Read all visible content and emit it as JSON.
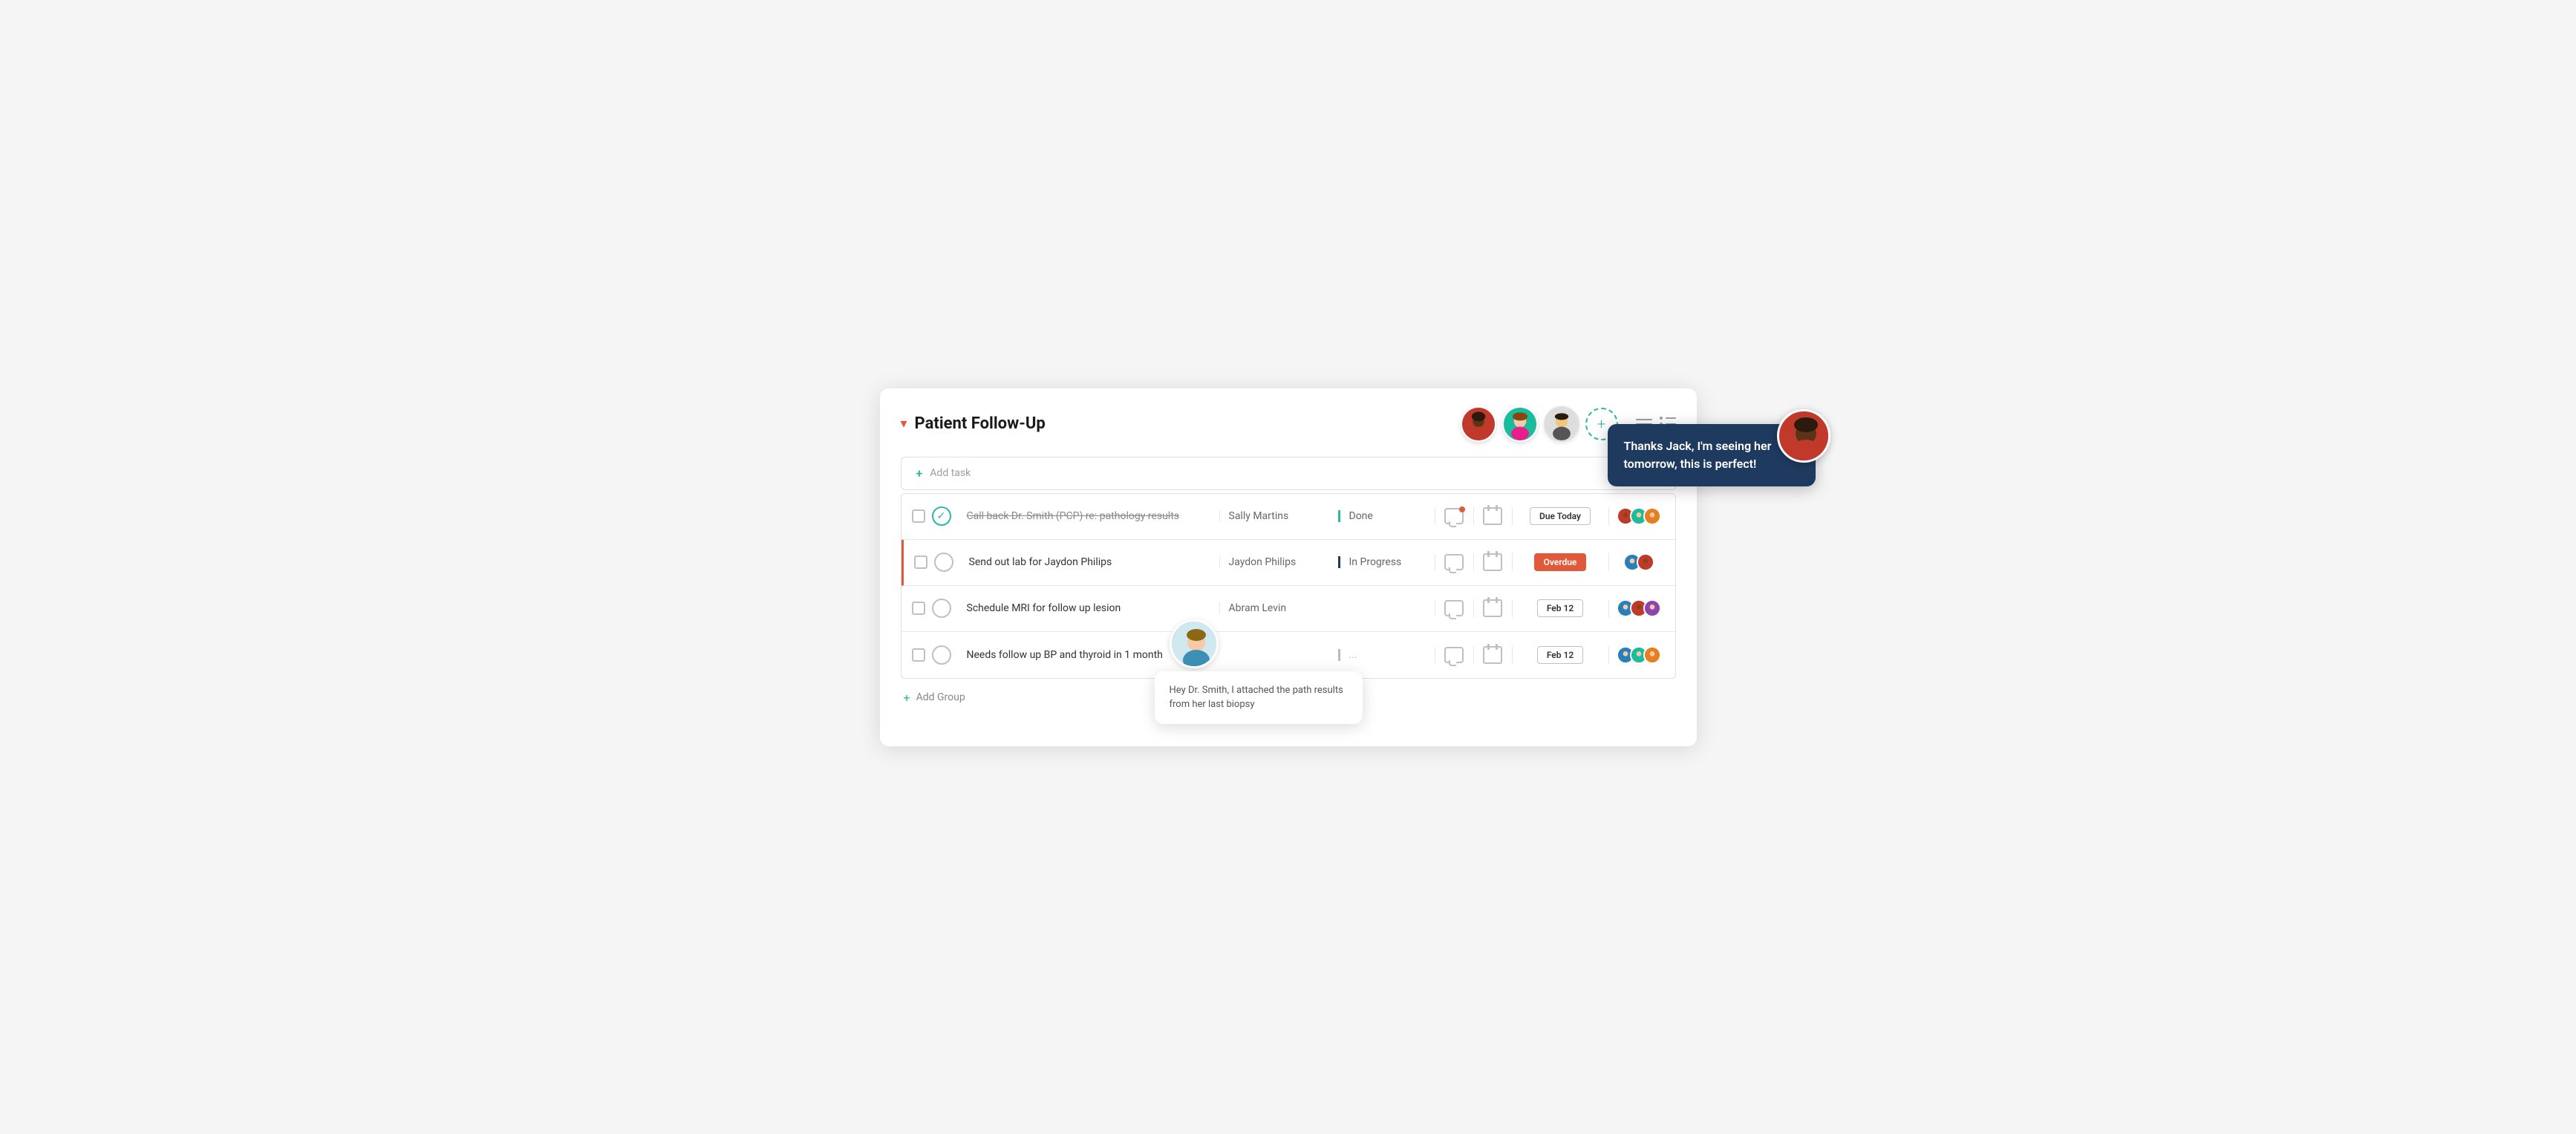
{
  "header": {
    "title": "Patient Follow-Up",
    "chevron": "▾"
  },
  "toolbar": {
    "add_task_label": "Add task",
    "add_group_label": "Add Group"
  },
  "tasks": [
    {
      "id": 1,
      "text": "Call back Dr. Smith (PCP) re: pathology results",
      "strikethrough": true,
      "completed": true,
      "assignee": "Sally Martins",
      "status": "Done",
      "status_border": "teal",
      "chat_dot": true,
      "due": "Due Today",
      "due_type": "normal",
      "avatars": [
        "red",
        "teal",
        "orange"
      ]
    },
    {
      "id": 2,
      "text": "Send out lab for Jaydon Philips",
      "strikethrough": false,
      "completed": false,
      "assignee": "Jaydon Philips",
      "status": "In Progress",
      "status_border": "dark",
      "overdue_border": true,
      "chat_dot": false,
      "due": "Overdue",
      "due_type": "overdue",
      "avatars": [
        "blue",
        "red"
      ]
    },
    {
      "id": 3,
      "text": "Schedule MRI for follow up lesion",
      "strikethrough": false,
      "completed": false,
      "assignee": "Abram Levin",
      "status": "",
      "status_border": "gray",
      "chat_dot": false,
      "due": "Feb 12",
      "due_type": "normal",
      "avatars": [
        "blue",
        "red",
        "purple"
      ]
    },
    {
      "id": 4,
      "text": "Needs follow up BP and thyroid in 1 month",
      "strikethrough": false,
      "completed": false,
      "assignee": "",
      "status": "...",
      "status_border": "gray",
      "chat_dot": false,
      "due": "Feb 12",
      "due_type": "normal",
      "avatars": [
        "blue",
        "teal",
        "orange"
      ]
    }
  ],
  "bubbles": {
    "lower": {
      "text": "Hey Dr. Smith, I attached the path results from her last biopsy"
    },
    "upper": {
      "text": "Thanks Jack, I'm seeing her tomorrow, this is perfect!"
    }
  }
}
